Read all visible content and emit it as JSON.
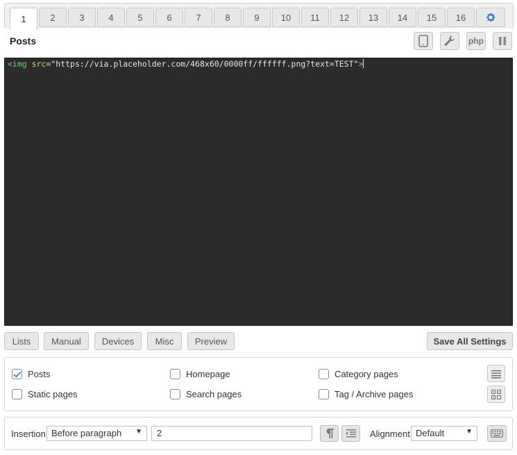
{
  "tabs": [
    "1",
    "2",
    "3",
    "4",
    "5",
    "6",
    "7",
    "8",
    "9",
    "10",
    "11",
    "12",
    "13",
    "14",
    "15",
    "16"
  ],
  "active_tab": "1",
  "block": {
    "title": "Posts",
    "php_label": "php"
  },
  "editor": {
    "tag": "<img",
    "attr": " src",
    "op": "=",
    "value": "\"https://via.placeholder.com/468x60/0000ff/ffffff.png?text=TEST\"",
    "close": ">"
  },
  "buttons": {
    "lists": "Lists",
    "manual": "Manual",
    "devices": "Devices",
    "misc": "Misc",
    "preview": "Preview",
    "save": "Save All Settings"
  },
  "checkboxes": {
    "posts": {
      "label": "Posts",
      "checked": true
    },
    "homepage": {
      "label": "Homepage",
      "checked": false
    },
    "category": {
      "label": "Category pages",
      "checked": false
    },
    "static": {
      "label": "Static pages",
      "checked": false
    },
    "search": {
      "label": "Search pages",
      "checked": false
    },
    "tag": {
      "label": "Tag / Archive pages",
      "checked": false
    }
  },
  "insertion": {
    "label": "Insertion",
    "selected": "Before paragraph",
    "paragraph_value": "2",
    "alignment_label": "Alignment",
    "alignment_selected": "Default"
  },
  "colors": {
    "accent": "#3b78d8",
    "editor_bg": "#2b2b2b",
    "check": "#3b78d8"
  }
}
